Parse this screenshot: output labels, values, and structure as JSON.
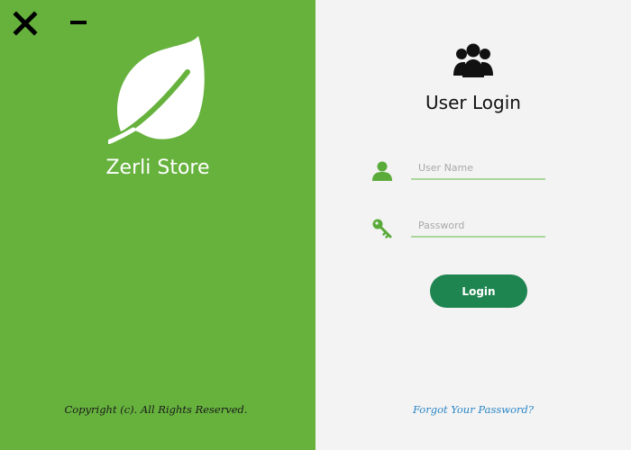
{
  "window": {
    "close_icon": "close-icon",
    "minimize_icon": "minimize-icon"
  },
  "brand": {
    "logo_icon": "leaf-icon",
    "name": "Zerli Store",
    "copyright": "Copyright (c). All Rights Reserved."
  },
  "login": {
    "header_icon": "users-group-icon",
    "title": "User Login",
    "username": {
      "icon": "user-icon",
      "placeholder": "User Name",
      "value": ""
    },
    "password": {
      "icon": "key-icon",
      "placeholder": "Password",
      "value": ""
    },
    "submit_label": "Login",
    "forgot_label": "Forgot Your Password?"
  },
  "colors": {
    "left_panel": "#66b23d",
    "right_panel": "#f3f3f3",
    "button": "#1f8550",
    "field_underline": "#a9d79a",
    "link": "#2a86c7"
  }
}
